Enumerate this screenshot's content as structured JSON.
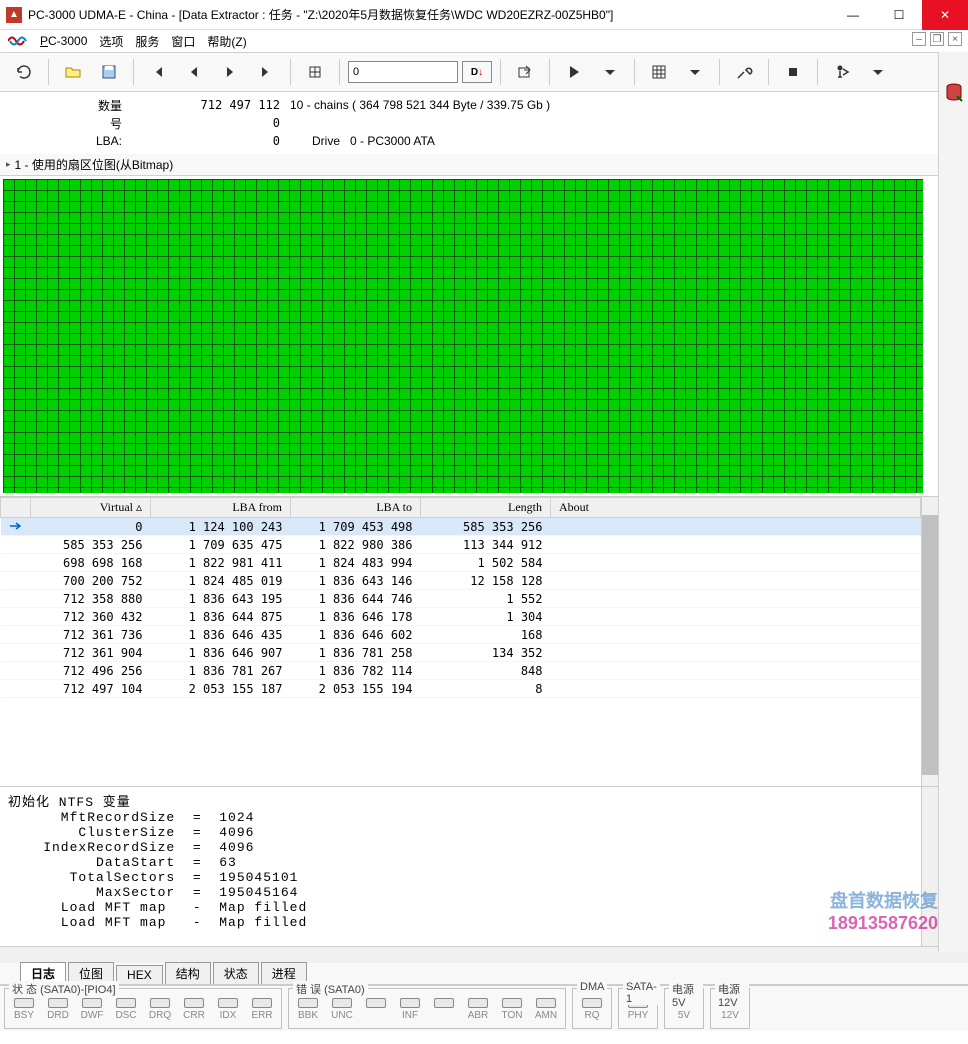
{
  "titlebar": {
    "title": "PC-3000 UDMA-E - China - [Data Extractor : 任务 - \"Z:\\2020年5月数据恢复任务\\WDC WD20EZRZ-00Z5HB0\"]"
  },
  "menu": {
    "pc3000": "PC-3000",
    "options": "选项",
    "service": "服务",
    "window": "窗口",
    "help": "帮助(Z)"
  },
  "toolbar": {
    "input_value": "0",
    "d_indicator": "D↓"
  },
  "info": {
    "count_label": "数量",
    "count_value": "712 497 112",
    "count_desc": "10 - chains  ( 364 798 521 344 Byte /  339.75 Gb )",
    "num_label": "号",
    "num_value": "0",
    "lba_label": "LBA:",
    "lba_value": "0",
    "drive_label": "Drive",
    "drive_value": "0 - PC3000 ATA"
  },
  "section1_title": "1 - 使用的扇区位图(从Bitmap)",
  "table": {
    "headers": {
      "virtual": "Virtual  ▵",
      "lba_from": "LBA from",
      "lba_to": "LBA to",
      "length": "Length",
      "about": "About"
    },
    "rows": [
      {
        "virtual": "0",
        "from": "1 124 100 243",
        "to": "1 709 453 498",
        "len": "585 353 256",
        "hl": true,
        "marker": true
      },
      {
        "virtual": "585 353 256",
        "from": "1 709 635 475",
        "to": "1 822 980 386",
        "len": "113 344 912"
      },
      {
        "virtual": "698 698 168",
        "from": "1 822 981 411",
        "to": "1 824 483 994",
        "len": "1 502 584"
      },
      {
        "virtual": "700 200 752",
        "from": "1 824 485 019",
        "to": "1 836 643 146",
        "len": "12 158 128"
      },
      {
        "virtual": "712 358 880",
        "from": "1 836 643 195",
        "to": "1 836 644 746",
        "len": "1 552"
      },
      {
        "virtual": "712 360 432",
        "from": "1 836 644 875",
        "to": "1 836 646 178",
        "len": "1 304"
      },
      {
        "virtual": "712 361 736",
        "from": "1 836 646 435",
        "to": "1 836 646 602",
        "len": "168"
      },
      {
        "virtual": "712 361 904",
        "from": "1 836 646 907",
        "to": "1 836 781 258",
        "len": "134 352"
      },
      {
        "virtual": "712 496 256",
        "from": "1 836 781 267",
        "to": "1 836 782 114",
        "len": "848"
      },
      {
        "virtual": "712 497 104",
        "from": "2 053 155 187",
        "to": "2 053 155 194",
        "len": "8"
      }
    ]
  },
  "log_lines": [
    "初始化 NTFS 变量",
    "      MftRecordSize  =  1024",
    "        ClusterSize  =  4096",
    "    IndexRecordSize  =  4096",
    "          DataStart  =  63",
    "       TotalSectors  =  195045101",
    "          MaxSector  =  195045164",
    "      Load MFT map   -  Map filled",
    "      Load MFT map   -  Map filled"
  ],
  "tabs": [
    "日志",
    "位图",
    "HEX",
    "结构",
    "状态",
    "进程"
  ],
  "active_tab": 0,
  "status": {
    "group1": {
      "label": "状 态 (SATA0)-[PIO4]",
      "leds": [
        "BSY",
        "DRD",
        "DWF",
        "DSC",
        "DRQ",
        "CRR",
        "IDX",
        "ERR"
      ]
    },
    "group2": {
      "label": "错 误 (SATA0)",
      "leds": [
        "BBK",
        "UNC",
        "",
        "INF",
        "",
        "ABR",
        "TON",
        "AMN"
      ]
    },
    "group3": {
      "label": "DMA",
      "leds": [
        "RQ"
      ]
    },
    "group4": {
      "label": "SATA-1",
      "leds": [
        "PHY"
      ]
    },
    "group5": {
      "label": "电源 5V",
      "leds": [
        "5V"
      ]
    },
    "group6": {
      "label": "电源 12V",
      "leds": [
        "12V"
      ]
    }
  },
  "watermark": {
    "l1": "盘首数据恢复",
    "l2": "18913587620"
  }
}
